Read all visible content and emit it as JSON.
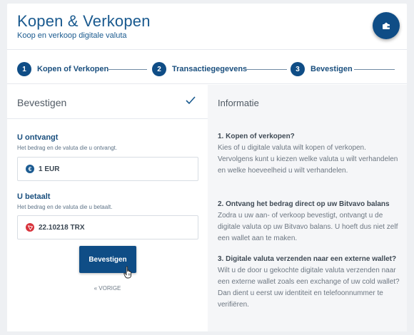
{
  "header": {
    "title": "Kopen & Verkopen",
    "subtitle": "Koop en verkoop digitale valuta",
    "wallet_icon": "wallet-icon"
  },
  "steps": [
    {
      "number": "1",
      "label": "Kopen of Verkopen"
    },
    {
      "number": "2",
      "label": "Transactiegegevens"
    },
    {
      "number": "3",
      "label": "Bevestigen"
    }
  ],
  "confirm_panel": {
    "title": "Bevestigen",
    "receive": {
      "label": "U ontvangt",
      "hint": "Het bedrag en de valuta die u ontvangt.",
      "coin_symbol": "€",
      "value": "1 EUR"
    },
    "pay": {
      "label": "U betaalt",
      "hint": "Het bedrag en de valuta die u betaalt.",
      "value": "22.10218 TRX"
    },
    "confirm_button": "Bevestigen",
    "previous_link": "« VORIGE"
  },
  "info_panel": {
    "title": "Informatie",
    "items": [
      {
        "question": "1. Kopen of verkopen?",
        "answer": "Kies of u digitale valuta wilt kopen of verkopen. Vervolgens kunt u kiezen welke valuta u wilt verhandelen en welke hoeveelheid u wilt verhandelen."
      },
      {
        "question": "2. Ontvang het bedrag direct op uw Bitvavo balans",
        "answer": "Zodra u uw aan- of verkoop bevestigt, ontvangt u de digitale valuta op uw Bitvavo balans. U hoeft dus niet zelf een wallet aan te maken."
      },
      {
        "question": "3. Digitale valuta verzenden naar een externe wallet?",
        "answer": "Wilt u de door u gekochte digitale valuta verzenden naar een externe wallet zoals een exchange of uw cold wallet? Dan dient u eerst uw identiteit en telefoonnummer te verifiëren."
      }
    ]
  },
  "colors": {
    "primary": "#0f4d86",
    "eur_coin": "#1d5c92",
    "trx_coin": "#d8343c"
  }
}
